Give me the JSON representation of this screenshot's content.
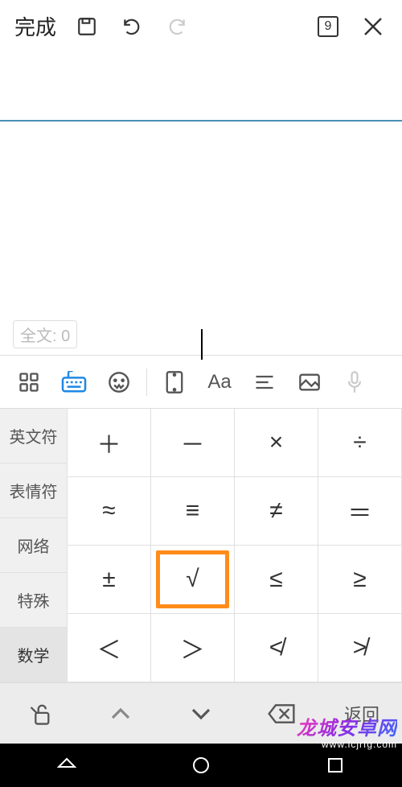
{
  "topbar": {
    "done": "完成",
    "keypad_num": "9"
  },
  "editor": {
    "fulltext_label": "全文: 0"
  },
  "keyboard": {
    "tabs": [
      "英文符",
      "表情符",
      "网络",
      "特殊",
      "数学"
    ],
    "selected_tab_index": 4,
    "keys": [
      "＋",
      "－",
      "×",
      "÷",
      "≈",
      "≡",
      "≠",
      "＝",
      "±",
      "√",
      "≤",
      "≥",
      "＜",
      "＞",
      "≮",
      "≯"
    ],
    "highlighted_key_index": 9,
    "return_label": "返回"
  },
  "watermark": {
    "text": "龙城安卓网",
    "url": "www.lcjrfg.com"
  }
}
